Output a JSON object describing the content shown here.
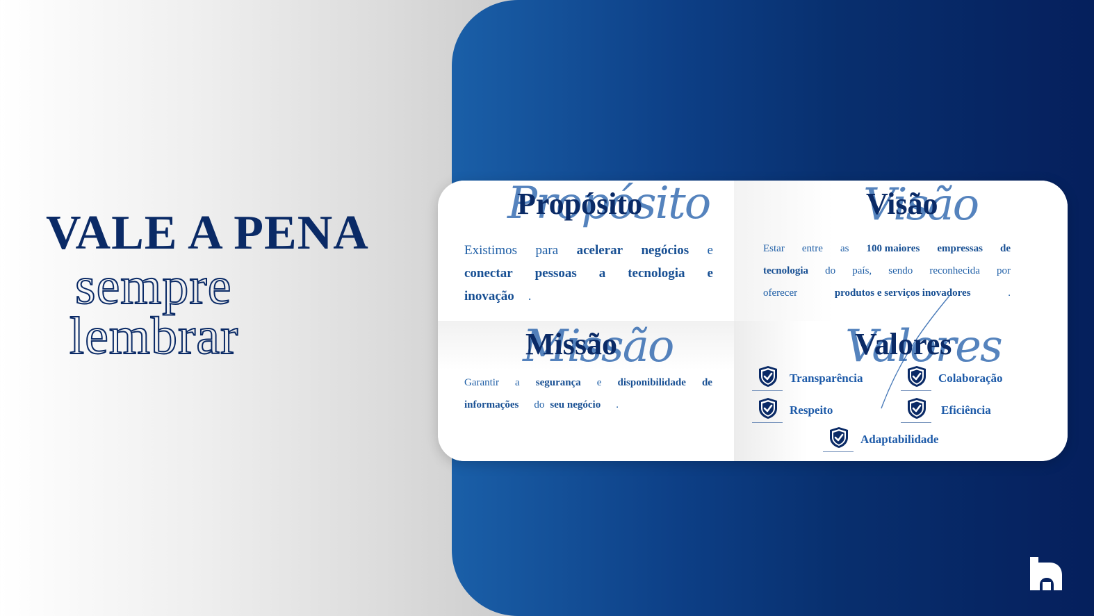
{
  "hero": {
    "line1": "VALE A PENA",
    "line2": "sempre",
    "line3": "lembrar"
  },
  "sections": {
    "proposito": {
      "title": "Propósito",
      "script": "Propósito",
      "w1": "Existimos",
      "w2": "para",
      "w3": "acelerar",
      "w4": "negócios",
      "w5": "e",
      "w6": "conectar",
      "w7": "pessoas",
      "w8": "a",
      "w9": "tecnologia",
      "w10": "e",
      "w11": "inovação",
      "w12": "."
    },
    "visao": {
      "title": "Visão",
      "script": "Visão",
      "w1": "Estar",
      "w2": "entre",
      "w3": "as",
      "w4": "100 maiores",
      "w5": "empressas",
      "w6": "de",
      "w7": "tecnologia",
      "w8": "do",
      "w9": "país,",
      "w10": "sendo",
      "w11": "reconhecida",
      "w12": "por",
      "w13": "oferecer",
      "w14": "produtos e serviços inovadores",
      "w15": "."
    },
    "missao": {
      "title": "Missão",
      "script": "Missão",
      "w1": "Garantir",
      "w2": "a",
      "w3": "segurança",
      "w4": "e",
      "w5": "disponibilidade",
      "w6": "de",
      "w7": "informações",
      "w8": "do",
      "w9": "seu negócio",
      "w10": "."
    },
    "valores": {
      "title": "Valores",
      "script": "Valores",
      "items": [
        "Transparência",
        "Colaboração",
        "Respeito",
        "Eficiência",
        "Adaptabilidade"
      ]
    }
  },
  "colors": {
    "navy": "#0a2a66",
    "accent_blue": "#1d5aa8",
    "panel_gradient_start": "#1a5fa8",
    "panel_gradient_end": "#051f5c"
  },
  "icons": {
    "value_icon": "shield-check-icon",
    "brand": "brand-logo-icon"
  }
}
